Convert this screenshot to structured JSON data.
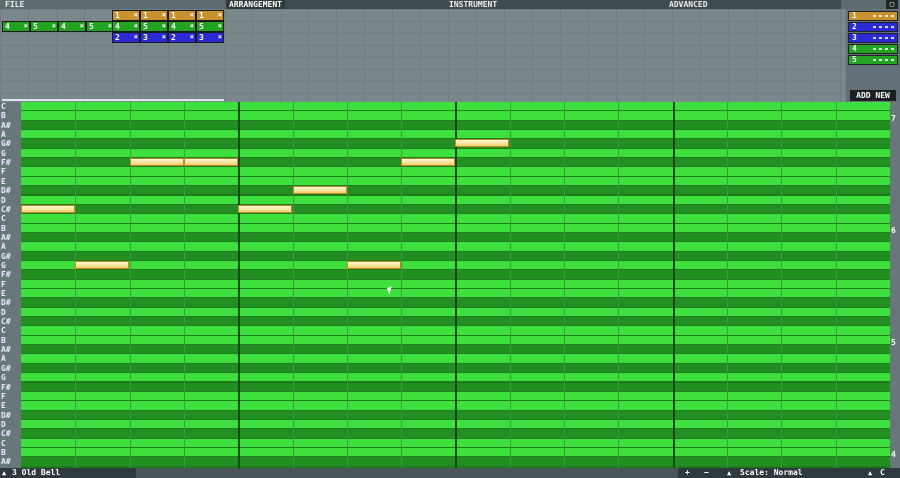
{
  "menu": {
    "file": "FILE",
    "arrangement": "ARRANGEMENT",
    "instrument": "INSTRUMENT",
    "advanced": "ADVANCED"
  },
  "sequence": {
    "row1": [
      {
        "label": "1"
      },
      {
        "label": "1"
      },
      {
        "label": "1"
      },
      {
        "label": "1"
      }
    ],
    "row2": [
      {
        "label": "4"
      },
      {
        "label": "5"
      },
      {
        "label": "4"
      },
      {
        "label": "5"
      },
      {
        "label": "4"
      },
      {
        "label": "5"
      },
      {
        "label": "4"
      },
      {
        "label": "5"
      }
    ],
    "row3": [
      {
        "label": "2"
      },
      {
        "label": "3"
      },
      {
        "label": "2"
      },
      {
        "label": "3"
      }
    ]
  },
  "patterns": [
    {
      "label": "1",
      "color": "#c8922e"
    },
    {
      "label": "2",
      "color": "#2b2bd6"
    },
    {
      "label": "3",
      "color": "#2b2bd6"
    },
    {
      "label": "4",
      "color": "#22a322"
    },
    {
      "label": "5",
      "color": "#22a322"
    }
  ],
  "add_new": "ADD NEW",
  "keys": [
    "C",
    "B",
    "A#",
    "A",
    "G#",
    "G",
    "F#",
    "F",
    "E",
    "D#",
    "D",
    "C#",
    "C",
    "B",
    "A#",
    "A",
    "G#",
    "G",
    "F#",
    "F",
    "E",
    "D#",
    "D",
    "C#",
    "C",
    "B",
    "A#",
    "A",
    "G#",
    "G",
    "F#",
    "F",
    "E",
    "D#",
    "D",
    "C#",
    "C",
    "B",
    "A#"
  ],
  "octaves": [
    "7",
    "6",
    "5",
    "4"
  ],
  "status": {
    "instrument": "3  Old Bell",
    "scale": "Scale: Normal",
    "key": "C"
  },
  "colors": {
    "row_light": "#3ee03e",
    "row_dark": "#238f23",
    "note": "#f5d98a"
  }
}
